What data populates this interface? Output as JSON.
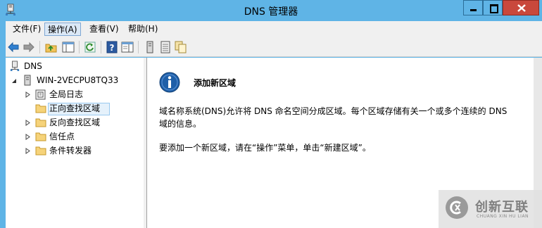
{
  "window": {
    "title": "DNS 管理器"
  },
  "menu": [
    {
      "label": "文件(F)",
      "active": false
    },
    {
      "label": "操作(A)",
      "active": true
    },
    {
      "label": "查看(V)",
      "active": false
    },
    {
      "label": "帮助(H)",
      "active": false
    }
  ],
  "tree": {
    "root": "DNS",
    "server": "WIN-2VECPU8TQ33",
    "items": [
      {
        "label": "全局日志",
        "icon": "log-icon"
      },
      {
        "label": "正向查找区域",
        "icon": "folder-icon",
        "selected": true
      },
      {
        "label": "反向查找区域",
        "icon": "folder-icon"
      },
      {
        "label": "信任点",
        "icon": "folder-icon"
      },
      {
        "label": "条件转发器",
        "icon": "folder-icon"
      }
    ]
  },
  "content": {
    "heading": "添加新区域",
    "para1_line1": "域名称系统(DNS)允许将 DNS 命名空间分成区域。每个区域存储有关一个或多个连续的 DNS",
    "para1_line2": "域的信息。",
    "para2": "要添加一个新区域，请在“操作”菜单，单击“新建区域”。"
  },
  "watermark": {
    "name": "创新互联",
    "sub": "CHUANG XIN HU LIAN"
  },
  "colors": {
    "titlebar": "#5fb4e6",
    "close": "#c9483c",
    "selection": "#e5f1fb",
    "info_icon": "#1f5fa8"
  }
}
